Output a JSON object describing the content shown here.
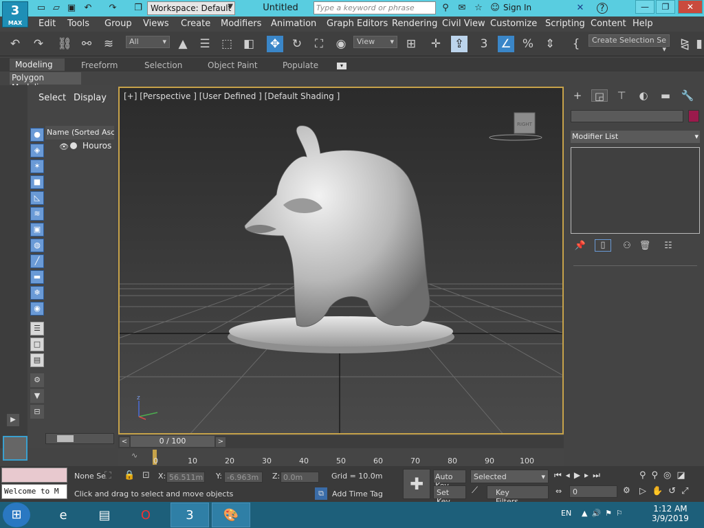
{
  "app": {
    "logo_main": "3",
    "logo_sub": "MAX",
    "workspace": "Workspace: Default",
    "doc_title": "Untitled",
    "search_placeholder": "Type a keyword or phrase",
    "sign_in": "Sign In",
    "help_label": "?"
  },
  "menus": [
    "Edit",
    "Tools",
    "Group",
    "Views",
    "Create",
    "Modifiers",
    "Animation",
    "Graph Editors",
    "Rendering",
    "Civil View",
    "Customize",
    "Scripting",
    "Content",
    "Help"
  ],
  "toolbar": {
    "filter_all": "All",
    "view_ref": "View",
    "create_selection": "Create Selection Se"
  },
  "ribbon": {
    "tabs": [
      "Modeling",
      "Freeform",
      "Selection",
      "Object Paint",
      "Populate"
    ],
    "active": "Modeling",
    "panel_label": "Polygon Modeling"
  },
  "scene_explorer": {
    "tabs": [
      "Select",
      "Display"
    ],
    "column_header": "Name (Sorted Ascer",
    "objects": [
      "Houros"
    ]
  },
  "viewport": {
    "label": "[+] [Perspective ] [User Defined ] [Default Shading ]",
    "view_cube": "RIGHT",
    "axis_z": "z"
  },
  "command_panel": {
    "modifier_list": "Modifier List",
    "object_color": "#9b1a4c"
  },
  "timeline": {
    "slider": "0 / 100",
    "ticks": [
      "0",
      "10",
      "20",
      "30",
      "40",
      "50",
      "60",
      "70",
      "80",
      "90",
      "100"
    ],
    "prev": "<",
    "next": ">"
  },
  "status": {
    "maxscript": "Welcome to M",
    "selection": "None Se",
    "x_label": "X:",
    "x_value": "56.511m",
    "y_label": "Y:",
    "y_value": "-6.963m",
    "z_label": "Z:",
    "z_value": "0.0m",
    "grid": "Grid = 10.0m",
    "hint": "Click and drag to select and move objects",
    "add_time_tag": "Add Time Tag",
    "auto_key": "Auto Key",
    "set_key": "Set Key",
    "key_mode": "Selected",
    "key_filters": "Key Filters...",
    "frame": "0"
  },
  "taskbar": {
    "lang": "EN",
    "time": "1:12 AM",
    "date": "3/9/2019"
  }
}
